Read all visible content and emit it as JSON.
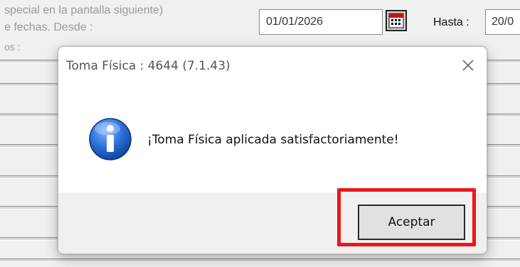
{
  "background": {
    "line1": "special en la pantalla siguiente)",
    "line2": "e fechas.  Desde :",
    "line3": "os :",
    "desde_value": "01/01/2026",
    "hasta_label": "Hasta :",
    "hasta_value": "20/0",
    "calendar_icon": "calendar-icon"
  },
  "dialog": {
    "title": "Toma Física : 4644  (7.1.43)",
    "message": "¡Toma Física aplicada satisfactoriamente!",
    "accept_label": "Aceptar",
    "close_icon": "close-icon",
    "info_icon": "info-icon"
  },
  "colors": {
    "highlight": "#e8181e",
    "info_blue": "#1f5fbf"
  }
}
